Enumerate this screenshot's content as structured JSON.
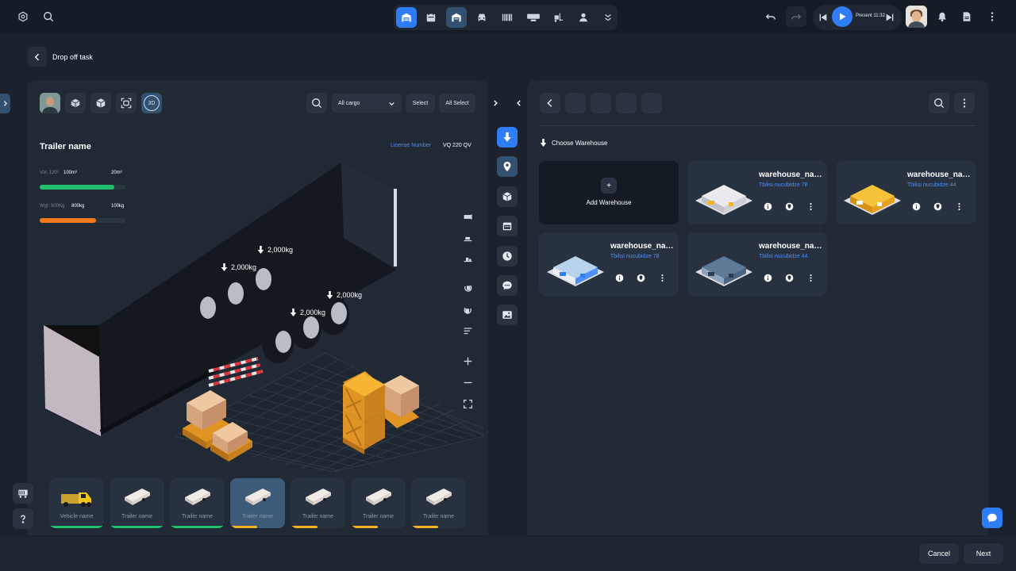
{
  "topbar": {
    "present_label": "Present 11:32"
  },
  "header": {
    "back_title": "Drop off task"
  },
  "left_panel": {
    "filter_select": "All cargo",
    "select_label": "Select",
    "all_select_label": "All Select",
    "view_3d_label": "3D",
    "trailer_name": "Trailer name",
    "license_label": "License Number",
    "license_value": "VQ 220 QV",
    "vol": {
      "label": "Vol: 120³",
      "current": "100m³",
      "max": "20m³",
      "fill_fraction": 0.87
    },
    "wgt": {
      "label": "Wgt: 900Kg",
      "current": "800kg",
      "max": "100kg",
      "fill_fraction": 0.66
    },
    "axle_weights": [
      "2,000kg",
      "2,000kg",
      "2,000kg",
      "2,000kg"
    ]
  },
  "vehicles": [
    {
      "label": "Vehicle name",
      "bar": "#1fbf6e",
      "selected": false,
      "type": "truck"
    },
    {
      "label": "Trailer name",
      "bar": "#1fbf6e",
      "selected": false,
      "type": "trailer"
    },
    {
      "label": "Trailer name",
      "bar": "#1fbf6e",
      "selected": false,
      "type": "trailer"
    },
    {
      "label": "Trailer name",
      "bar": "#f5b324",
      "selected": true,
      "type": "trailer"
    },
    {
      "label": "Trailer name",
      "bar": "#f5b324",
      "selected": false,
      "type": "trailer"
    },
    {
      "label": "Trailer name",
      "bar": "#f5b324",
      "selected": false,
      "type": "trailer"
    },
    {
      "label": "Trailer name",
      "bar": "#f5b324",
      "selected": false,
      "type": "trailer"
    }
  ],
  "right_panel": {
    "choose_label": "Choose Warehouse",
    "add_label": "Add Warehouse",
    "add_icon": "+",
    "warehouses": [
      {
        "name": "warehouse_name",
        "address": "Tbilisi nucubidze 78",
        "style": "white-yellow"
      },
      {
        "name": "warehouse_name",
        "address": "Tbilisi nucubidze 44",
        "style": "yellow"
      },
      {
        "name": "warehouse_name",
        "address": "Tbilisi nucubidze 78",
        "style": "blue"
      },
      {
        "name": "warehouse_name",
        "address": "Tbilisi nucubidze 44",
        "style": "grey"
      }
    ]
  },
  "footer": {
    "cancel_label": "Cancel",
    "next_label": "Next"
  },
  "colors": {
    "accent": "#2e7cf6",
    "success": "#1fbf6e",
    "warning": "#f47a20",
    "link": "#4f8ff7"
  }
}
